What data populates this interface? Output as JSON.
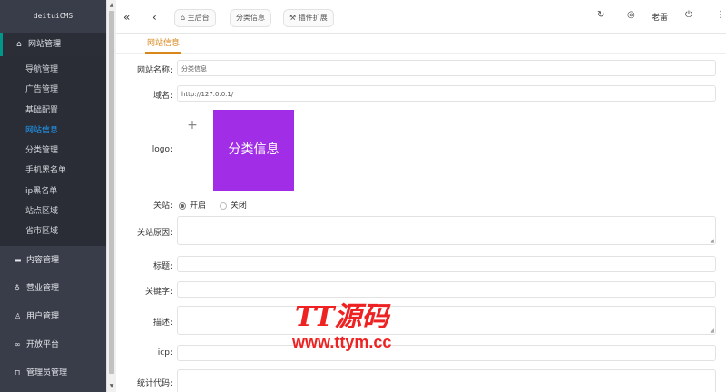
{
  "sidebar": {
    "brand": "deituiCMS",
    "active_group": {
      "icon": "home-icon",
      "label": "网站管理"
    },
    "items": [
      {
        "label": "导航管理"
      },
      {
        "label": "广告管理"
      },
      {
        "label": "基础配置"
      },
      {
        "label": "网站信息"
      },
      {
        "label": "分类管理"
      },
      {
        "label": "手机黑名单"
      },
      {
        "label": "ip黑名单"
      },
      {
        "label": "站点区域"
      },
      {
        "label": "省市区域"
      }
    ],
    "groups": [
      {
        "icon": "card-icon",
        "label": "内容管理"
      },
      {
        "icon": "shop-icon",
        "label": "营业管理"
      },
      {
        "icon": "user-icon",
        "label": "用户管理"
      },
      {
        "icon": "link-icon",
        "label": "开放平台"
      },
      {
        "icon": "lock-icon",
        "label": "管理员管理"
      }
    ]
  },
  "header": {
    "pill_home": "主后台",
    "pill_category": "分类信息",
    "pill_plugins": "插件扩展",
    "user": "老雷"
  },
  "tab": {
    "label": "网站信息"
  },
  "form": {
    "site_name_label": "网站名称:",
    "site_name_value": "分类信息",
    "domain_label": "域名:",
    "domain_value": "http://127.0.0.1/",
    "logo_label": "logo:",
    "logo_text": "分类信息",
    "close_label": "关站:",
    "close_on": "开启",
    "close_off": "关闭",
    "close_reason_label": "关站原因:",
    "title_label": "标题:",
    "keywords_label": "关键字:",
    "description_label": "描述:",
    "icp_label": "icp:",
    "stats_label": "统计代码:"
  },
  "watermark": {
    "top": "TT源码",
    "bottom": "www.ttym.cc"
  },
  "colors": {
    "sidebar": "#393d49",
    "accent": "#d9861a",
    "logo": "#a12ee6",
    "active_link": "#1e9fff"
  }
}
